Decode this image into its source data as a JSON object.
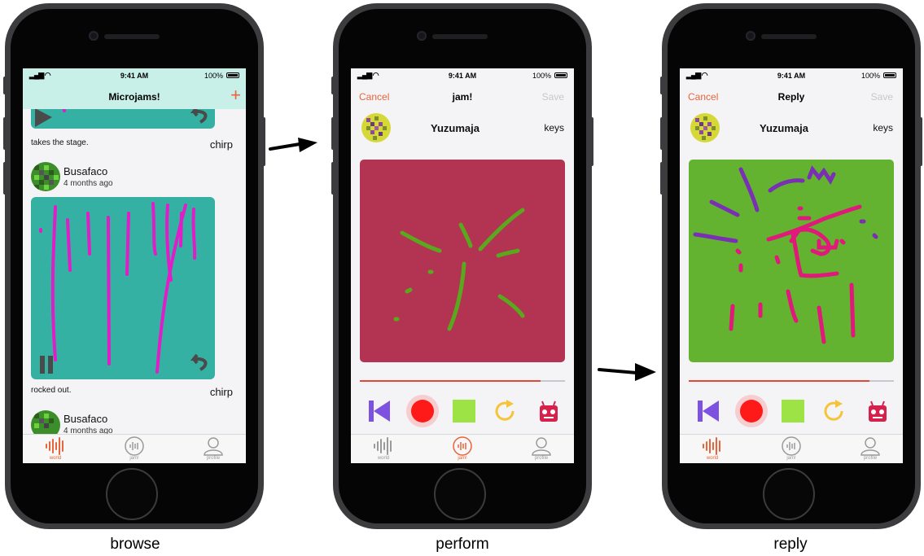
{
  "status": {
    "time": "9:41 AM",
    "battery": "100%"
  },
  "browse": {
    "nav_title": "Microjams!",
    "add_icon": "plus-icon",
    "posts": [
      {
        "caption": "takes the stage.",
        "reply_label": "chirp"
      },
      {
        "user": "Busafaco",
        "time_ago": "4 months ago",
        "caption": "rocked out.",
        "reply_label": "chirp"
      },
      {
        "user": "Busafaco",
        "time_ago": "4 months ago"
      }
    ]
  },
  "perform": {
    "nav_left": "Cancel",
    "nav_title": "jam!",
    "nav_right": "Save",
    "performer": "Yuzumaja",
    "instrument": "keys",
    "canvas_color": "#b33352",
    "stroke_color": "#5aa81e",
    "progress": 0.88
  },
  "reply": {
    "nav_left": "Cancel",
    "nav_title": "Reply",
    "nav_right": "Save",
    "performer": "Yuzumaja",
    "instrument": "keys",
    "canvas_color": "#63b330",
    "stroke_colors": [
      "#7a2fb5",
      "#e0197a"
    ],
    "progress": 0.88
  },
  "tabs": [
    {
      "label": "world",
      "icon": "waveform-icon"
    },
    {
      "label": "jam!",
      "icon": "jam-circle-icon"
    },
    {
      "label": "profile",
      "icon": "person-icon"
    }
  ],
  "controls": [
    "skip-back-icon",
    "record-icon",
    "stop-square-icon",
    "loop-icon",
    "robot-icon"
  ],
  "captions": {
    "browse": "browse",
    "perform": "perform",
    "reply": "reply"
  },
  "colors": {
    "accent": "#e8643a",
    "teal": "#35b1a4",
    "magenta": "#e01ec8"
  }
}
